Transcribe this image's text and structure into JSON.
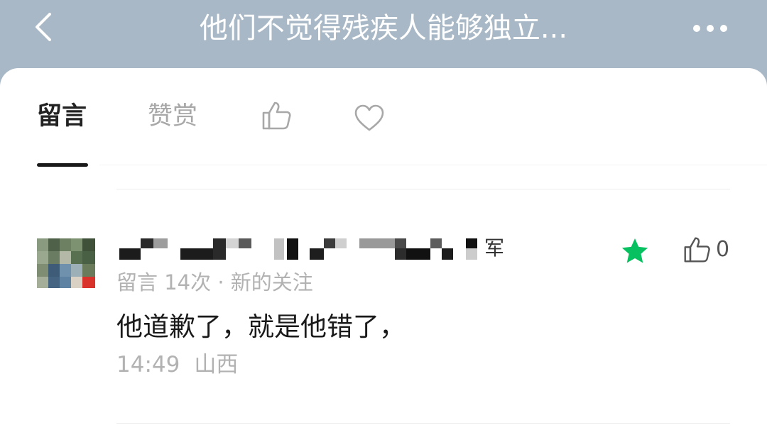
{
  "nav": {
    "back_icon": "chevron-left-icon",
    "title": "他们不觉得残疾人能够独立...",
    "more_icon": "more-horizontal-icon"
  },
  "tabs": {
    "comments_label": "留言",
    "reward_label": "赞赏",
    "like_icon": "thumbs-up-icon",
    "favorite_icon": "heart-icon",
    "active": "comments"
  },
  "comment": {
    "avatar_icon": "avatar",
    "nickname_visible_tail": "军",
    "meta": "留言 14次 · 新的关注",
    "text": "他道歉了，就是他错了，",
    "time": "14:49",
    "location": "山西",
    "starred": true,
    "star_icon": "star-icon",
    "like_icon": "thumbs-up-icon",
    "like_count": "0"
  },
  "colors": {
    "header_bg": "#a9b8c6",
    "star": "#07c160",
    "primary_text": "#1a1a1a",
    "secondary_text": "#b2b2b2",
    "inactive_tab": "#a8a8a8"
  }
}
